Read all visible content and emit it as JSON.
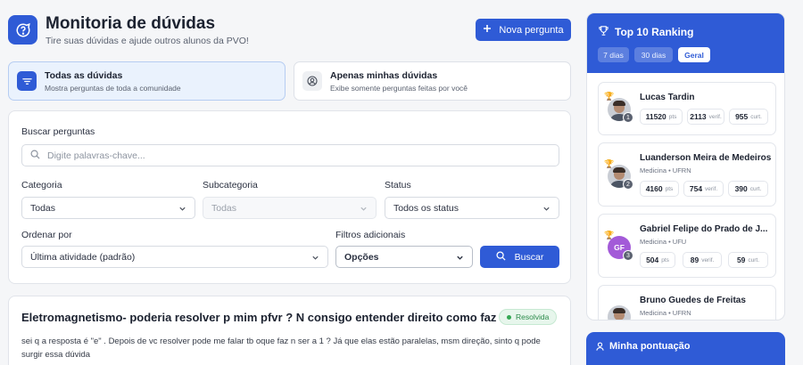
{
  "header": {
    "title": "Monitoria de dúvidas",
    "subtitle": "Tire suas dúvidas e ajude outros alunos da PVO!",
    "new_question_label": "Nova pergunta"
  },
  "filters": [
    {
      "title": "Todas as dúvidas",
      "desc": "Mostra perguntas de toda a comunidade",
      "active": true
    },
    {
      "title": "Apenas minhas dúvidas",
      "desc": "Exibe somente perguntas feitas por você",
      "active": false
    }
  ],
  "search": {
    "label": "Buscar perguntas",
    "placeholder": "Digite palavras-chave...",
    "category_label": "Categoria",
    "category_value": "Todas",
    "subcategory_label": "Subcategoria",
    "subcategory_value": "Todas",
    "status_label": "Status",
    "status_value": "Todos os status",
    "order_label": "Ordenar por",
    "order_value": "Última atividade (padrão)",
    "extra_label": "Filtros adicionais",
    "extra_value": "Opções",
    "button_label": "Buscar"
  },
  "question": {
    "title": "Eletromagnetismo- poderia resolver p mim pfvr ? N consigo entender direito como faz",
    "badge": "Resolvida",
    "body": "sei q a resposta é \"e\" . Depois de vc resolver pode me falar tb oque faz n ser a 1 ? Já que elas estão paralelas, msm direção, sinto q pode surgir essa dúvida"
  },
  "ranking": {
    "title": "Top 10 Ranking",
    "tabs": [
      {
        "label": "7 dias",
        "active": false
      },
      {
        "label": "30 dias",
        "active": false
      },
      {
        "label": "Geral",
        "active": true
      }
    ],
    "users": [
      {
        "rank": "1",
        "name": "Lucas Tardin",
        "meta": "",
        "pts": "11520",
        "pts_unit": "pts",
        "verif": "2113",
        "verif_unit": "verif.",
        "curt": "955",
        "curt_unit": "curt."
      },
      {
        "rank": "2",
        "name": "Luanderson Meira de Medeiros",
        "meta": "Medicina • UFRN",
        "pts": "4160",
        "pts_unit": "pts",
        "verif": "754",
        "verif_unit": "verif.",
        "curt": "390",
        "curt_unit": "curt."
      },
      {
        "rank": "3",
        "name": "Gabriel Felipe do Prado de J...",
        "meta": "Medicina • UFU",
        "initials": "GF",
        "pts": "504",
        "pts_unit": "pts",
        "verif": "89",
        "verif_unit": "verif.",
        "curt": "59",
        "curt_unit": "curt."
      },
      {
        "rank": "",
        "name": "Bruno Guedes de Freitas",
        "meta": "Medicina • UFRN"
      }
    ]
  },
  "score": {
    "title": "Minha pontuação"
  },
  "colors": {
    "primary": "#2f5bd6",
    "success": "#34a853",
    "gold": "#e8b93a"
  }
}
